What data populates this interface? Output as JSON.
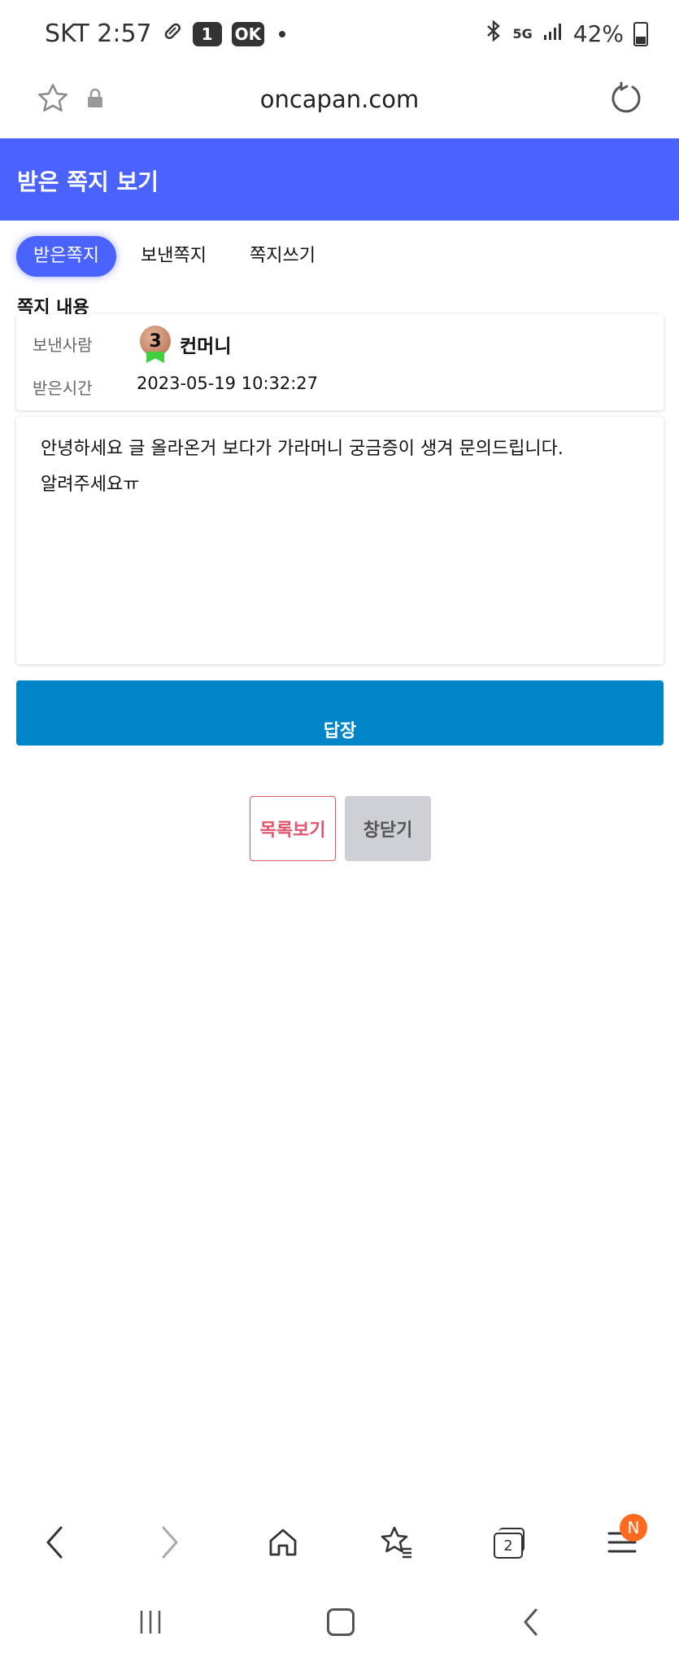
{
  "status_bar": {
    "carrier_time": "SKT 2:57",
    "notif_badge": "1",
    "ok_badge": "OK",
    "network": "5G",
    "battery": "42%"
  },
  "browser": {
    "url": "oncapan.com",
    "tabs_count": "2",
    "menu_badge": "N"
  },
  "header": {
    "title": "받은 쪽지 보기"
  },
  "tabs": [
    {
      "label": "받은쪽지",
      "active": true
    },
    {
      "label": "보낸쪽지",
      "active": false
    },
    {
      "label": "쪽지쓰기",
      "active": false
    }
  ],
  "section_label": "쪽지 내용",
  "message_meta": {
    "sender_label": "보낸사람",
    "sender_level": "3",
    "sender_name": "컨머니",
    "time_label": "받은시간",
    "time_value": "2023-05-19 10:32:27"
  },
  "message_body": "안녕하세요 글 올라온거 보다가 가라머니 궁금증이 생겨 문의드립니다.\n알려주세요ㅠ",
  "buttons": {
    "reply": "답장",
    "list": "목록보기",
    "close": "창닫기"
  },
  "colors": {
    "header_blue": "#4a63ff",
    "reply_blue": "#0085c8",
    "list_red": "#e0566b",
    "close_gray": "#cfd0d6",
    "menu_badge_orange": "#ff6a1f"
  }
}
